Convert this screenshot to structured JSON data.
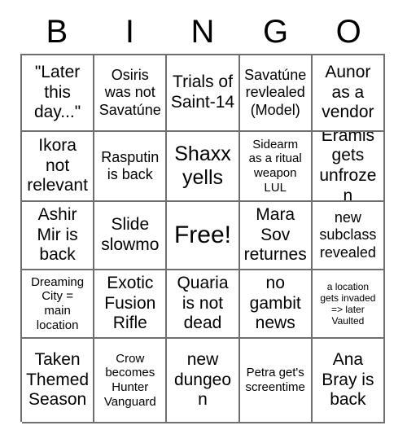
{
  "card": {
    "header_letters": [
      "B",
      "I",
      "N",
      "G",
      "O"
    ],
    "colors": {
      "background": "#ffffff",
      "text": "#000000",
      "grid_line": "#6e6e6e"
    },
    "rows": [
      [
        {
          "text": "\"Later\nthis\nday...\"",
          "size": "lg"
        },
        {
          "text": "Osiris\nwas not\nSavatúne",
          "size": "md"
        },
        {
          "text": "Trials of\nSaint-14",
          "size": "lg"
        },
        {
          "text": "Savatúne\nrevlealed\n(Model)",
          "size": "md"
        },
        {
          "text": "Aunor\nas a\nvendor",
          "size": "lg"
        }
      ],
      [
        {
          "text": "Ikora\nnot\nrelevant",
          "size": "lg"
        },
        {
          "text": "Rasputin\nis back",
          "size": "md"
        },
        {
          "text": "Shaxx\nyells",
          "size": "xl"
        },
        {
          "text": "Sidearm\nas a ritual\nweapon\nLUL",
          "size": "sm"
        },
        {
          "text": "Eramis\ngets\nunfrozen",
          "size": "lg"
        }
      ],
      [
        {
          "text": "Ashir\nMir is\nback",
          "size": "lg"
        },
        {
          "text": "Slide\nslowmo",
          "size": "lg"
        },
        {
          "text": "Free!",
          "size": "xxl"
        },
        {
          "text": "Mara\nSov\nreturnes",
          "size": "lg"
        },
        {
          "text": "new\nsubclass\nrevealed",
          "size": "md"
        }
      ],
      [
        {
          "text": "Dreaming\nCity =\nmain\nlocation",
          "size": "sm"
        },
        {
          "text": "Exotic\nFusion\nRifle",
          "size": "lg"
        },
        {
          "text": "Quaria\nis not\ndead",
          "size": "lg"
        },
        {
          "text": "no\ngambit\nnews",
          "size": "lg"
        },
        {
          "text": "a location\ngets invaded\n=> later\nVaulted",
          "size": "xs"
        }
      ],
      [
        {
          "text": "Taken\nThemed\nSeason",
          "size": "lg"
        },
        {
          "text": "Crow\nbecomes\nHunter\nVanguard",
          "size": "sm"
        },
        {
          "text": "new\ndungeon",
          "size": "lg"
        },
        {
          "text": "Petra get's\nscreentime",
          "size": "sm"
        },
        {
          "text": "Ana\nBray is\nback",
          "size": "lg"
        }
      ]
    ]
  }
}
